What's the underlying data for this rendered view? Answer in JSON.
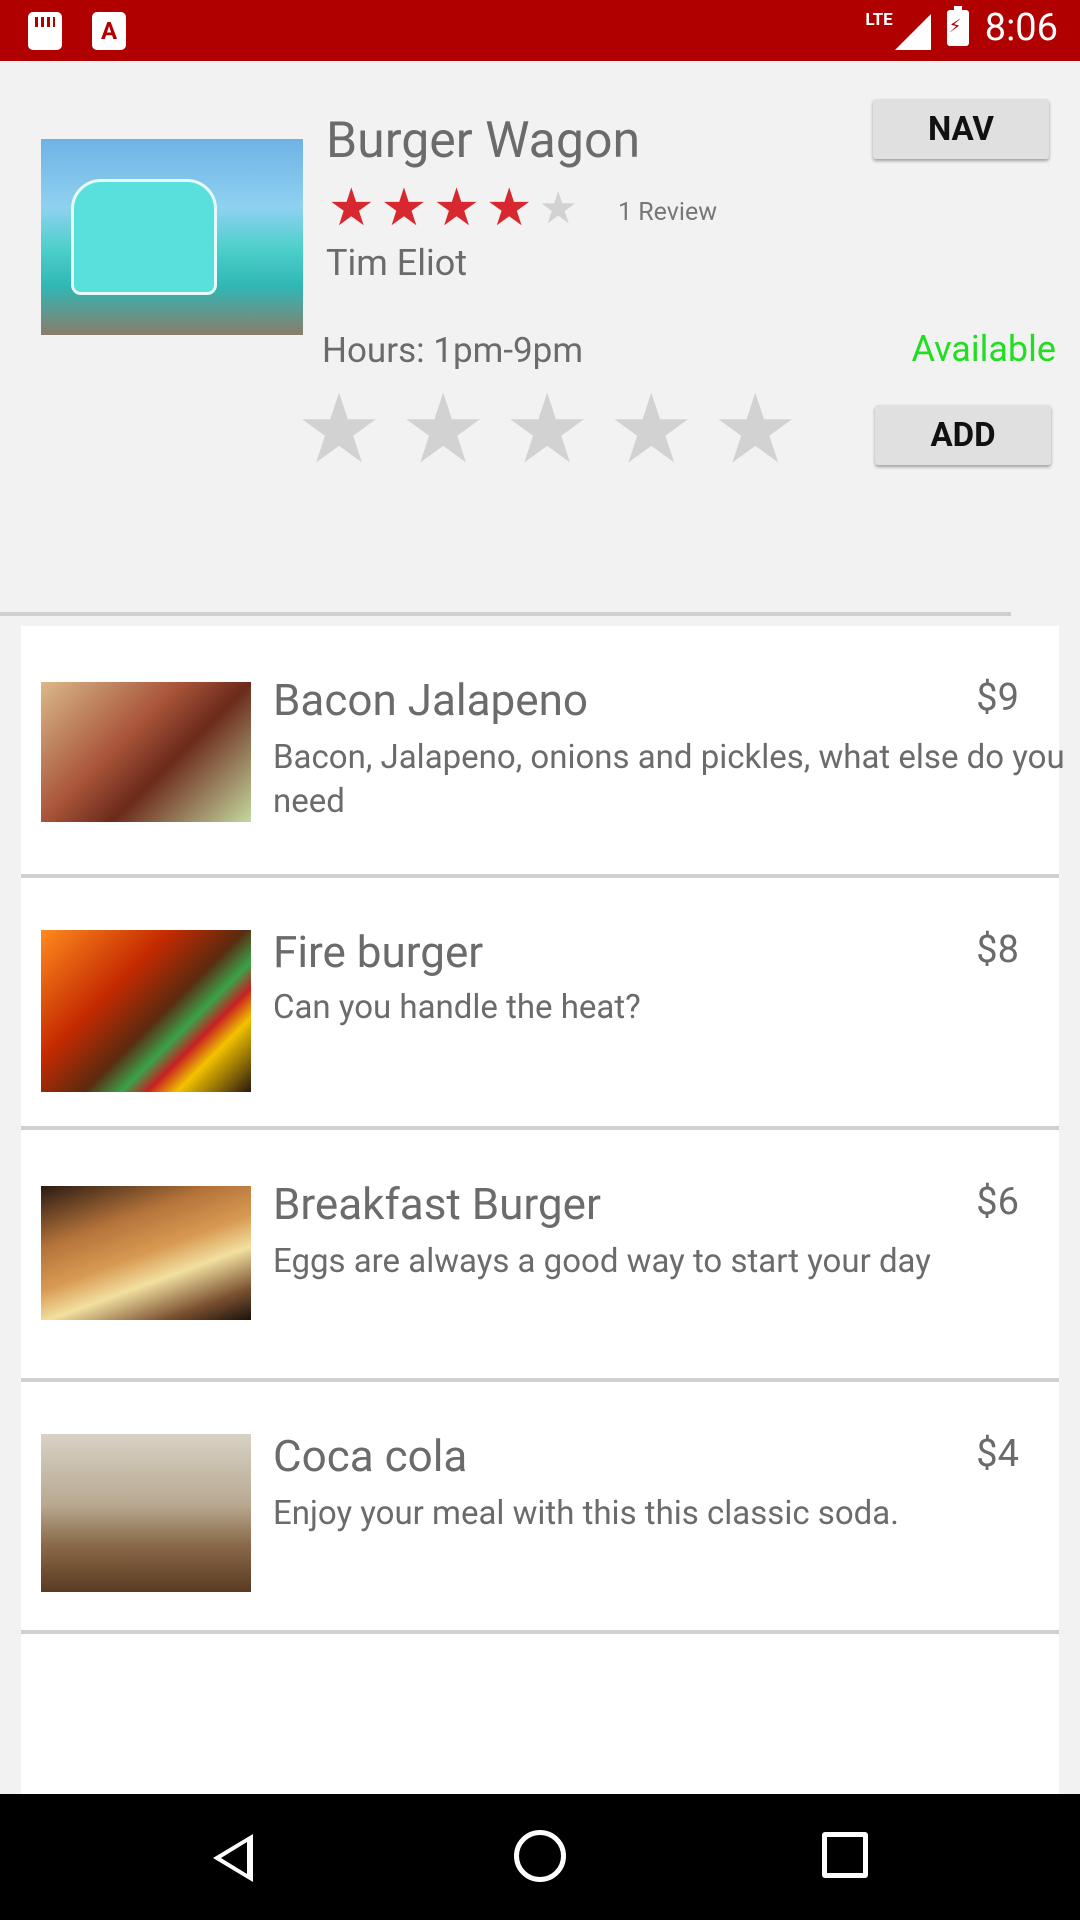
{
  "status_bar": {
    "time": "8:06",
    "network": "LTE",
    "icons": [
      "sd-card-icon",
      "app-icon",
      "signal-icon",
      "battery-charging-icon"
    ]
  },
  "truck": {
    "name": "Burger Wagon",
    "rating": 4,
    "rating_max": 5,
    "review_count": "1 Review",
    "owner": "Tim Eliot",
    "hours": "Hours: 1pm-9pm",
    "availability": "Available",
    "nav_label": "NAV",
    "add_label": "ADD",
    "user_rating": 0
  },
  "colors": {
    "status_bar": "#b00000",
    "star_filled": "#d7282f",
    "star_empty": "#d2d2d2",
    "available": "#22dd22"
  },
  "menu": {
    "items": [
      {
        "name": "Bacon Jalapeno",
        "price": "$9",
        "description": "Bacon, Jalapeno, onions and pickles, what else do you need"
      },
      {
        "name": "Fire burger",
        "price": "$8",
        "description": "Can you handle the heat?"
      },
      {
        "name": "Breakfast Burger",
        "price": "$6",
        "description": "Eggs are always a good way to start your day"
      },
      {
        "name": "Coca cola",
        "price": "$4",
        "description": "Enjoy your meal with this this classic soda."
      }
    ]
  },
  "nav_bar": {
    "buttons": [
      "back-icon",
      "home-icon",
      "recent-apps-icon"
    ]
  }
}
